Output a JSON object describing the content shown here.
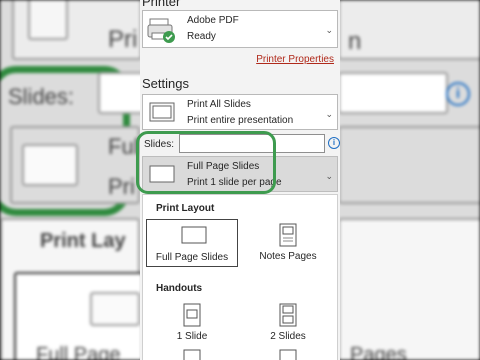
{
  "background": {
    "printer_partial": "Pri",
    "printer_suffix": "n",
    "slides_label": "Slides:",
    "full_partial": "Ful",
    "print_partial": "Pri",
    "print_layout_partial": "Print Lay",
    "full_page_partial": "Full Page",
    "pages_partial": "Pages",
    "info_glyph": "i"
  },
  "printer": {
    "heading": "Printer",
    "name": "Adobe PDF",
    "status": "Ready",
    "properties_link": "Printer Properties"
  },
  "settings": {
    "heading": "Settings",
    "range": {
      "title": "Print All Slides",
      "subtitle": "Print entire presentation"
    },
    "slides_label": "Slides:",
    "slides_value": "",
    "info_glyph": "i",
    "layout": {
      "title": "Full Page Slides",
      "subtitle": "Print 1 slide per page"
    }
  },
  "dropdown": {
    "print_layout_heading": "Print Layout",
    "layouts": [
      {
        "label": "Full Page Slides",
        "selected": true
      },
      {
        "label": "Notes Pages",
        "selected": false
      }
    ],
    "handouts_heading": "Handouts",
    "handouts": [
      {
        "label": "1 Slide"
      },
      {
        "label": "2 Slides"
      }
    ]
  },
  "colors": {
    "highlight_ring": "#3e9b4f",
    "link": "#b0291a",
    "info": "#1f6fc4"
  }
}
